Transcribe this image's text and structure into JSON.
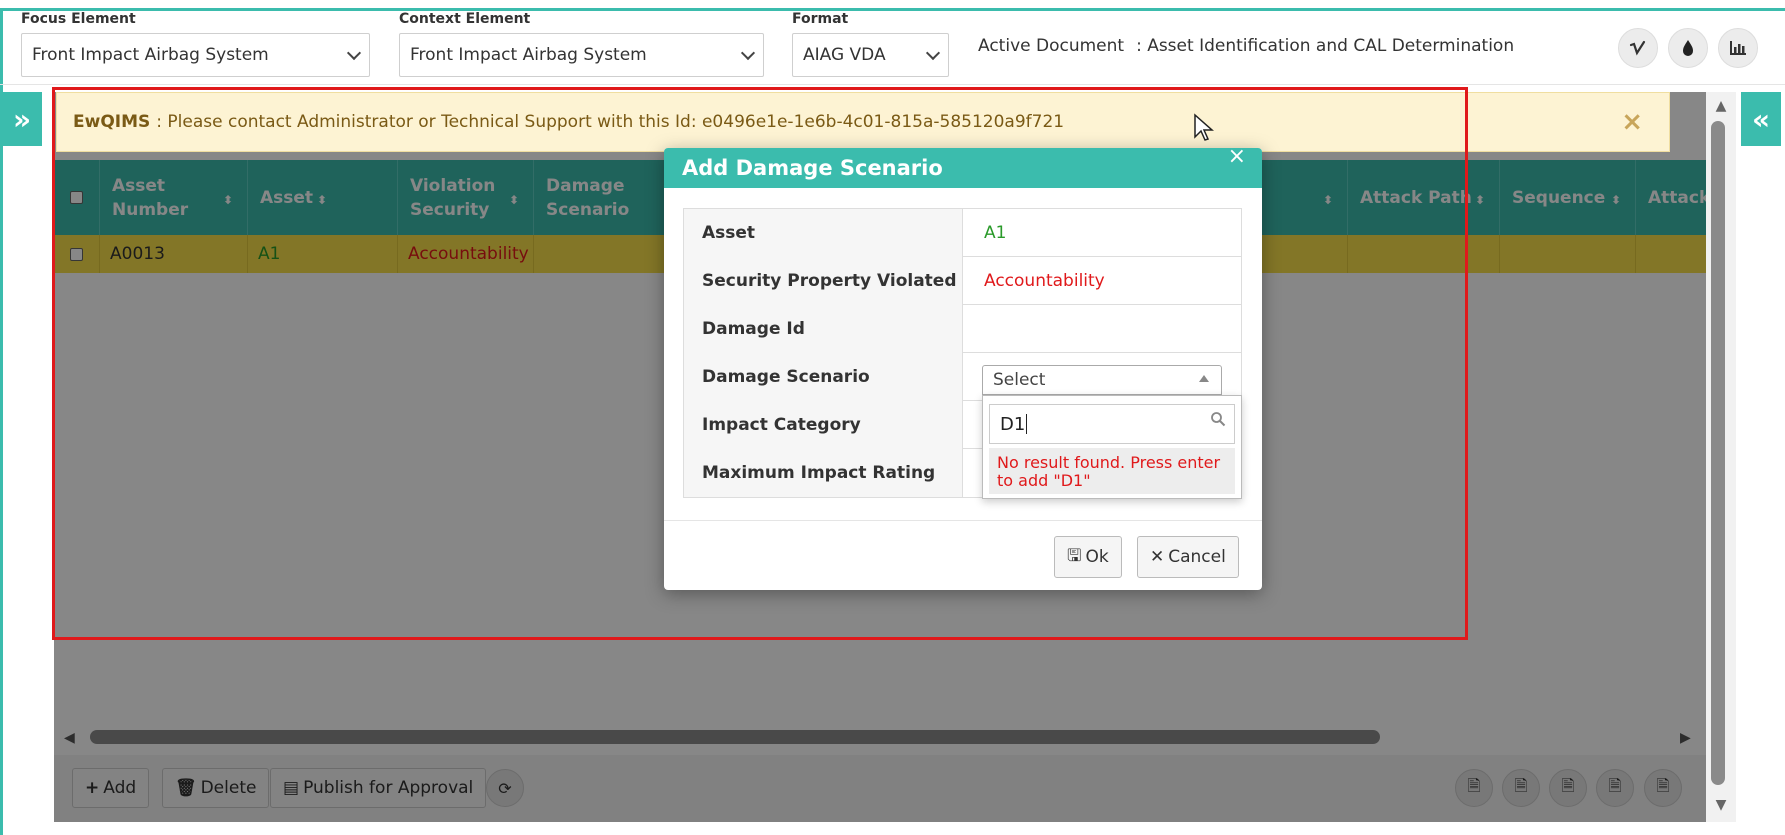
{
  "header": {
    "focus_label": "Focus Element",
    "focus_value": "Front Impact Airbag System",
    "context_label": "Context Element",
    "context_value": "Front Impact Airbag System",
    "format_label": "Format",
    "format_value": "AIAG VDA",
    "active_doc_label": "Active Document",
    "active_doc_value": ": Asset Identification and CAL Determination",
    "icons": [
      "vimeo-icon",
      "drop-icon",
      "bar-chart-icon"
    ]
  },
  "alert": {
    "brand": "EwQIMS",
    "message": ": Please contact Administrator or Technical Support with this Id: e0496e1e-1e6b-4c01-815a-585120a9f721"
  },
  "table": {
    "columns": [
      "Asset Number",
      "Asset",
      "Violation Security",
      "Damage Scenario",
      "Attack Path",
      "Sequence",
      "Attack Path S"
    ],
    "rows": [
      {
        "asset_number": "A0013",
        "asset": "A1",
        "violation": "Accountability"
      }
    ]
  },
  "toolbar": {
    "add_label": "Add",
    "delete_label": "Delete",
    "publish_label": "Publish for Approval",
    "export_icons": [
      "document-icon",
      "document-icon",
      "document-icon",
      "document-icon",
      "document-icon"
    ]
  },
  "modal": {
    "title": "Add Damage Scenario",
    "fields": [
      {
        "label": "Asset",
        "value": "A1"
      },
      {
        "label": "Security Property Violated",
        "value": "Accountability"
      },
      {
        "label": "Damage Id",
        "value": ""
      },
      {
        "label": "Damage Scenario",
        "value": "Select"
      },
      {
        "label": "Impact Category",
        "value": ""
      },
      {
        "label": "Maximum Impact Rating",
        "value": ""
      }
    ],
    "ok_label": "Ok",
    "cancel_label": "Cancel",
    "dropdown": {
      "search_value": "D1",
      "message": "No result found. Press enter to add \"D1\""
    }
  },
  "colors": {
    "accent": "#3bbcad",
    "row_highlight": "#f7df4a",
    "error": "#e0191b",
    "asset_green": "#2a9a2a"
  }
}
